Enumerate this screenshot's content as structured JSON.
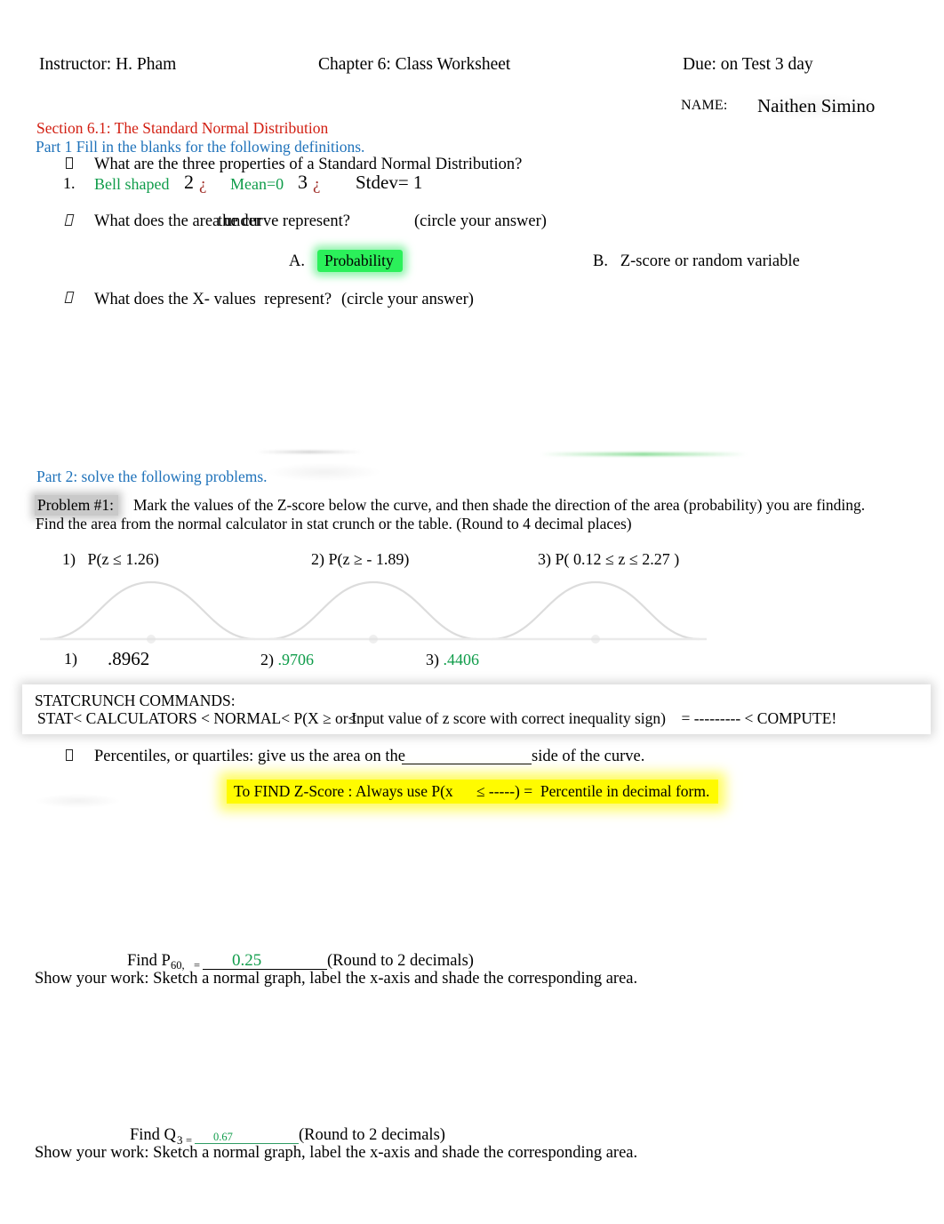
{
  "header": {
    "instructor": "Instructor: H. Pham",
    "title": "Chapter 6: Class Worksheet",
    "due": "Due: on Test 3 day",
    "name_label": "NAME:",
    "name_value": "Naithen Simino"
  },
  "section": {
    "title": "Section 6.1: The Standard Normal Distribution",
    "part1": "Part 1 Fill in the blanks for the following definitions.",
    "part2": "Part 2: solve the following problems."
  },
  "question1": {
    "prompt": "What are the three properties of a Standard Normal Distribution?",
    "num1": "1.",
    "prop1": "Bell shaped",
    "num2": "2",
    "q2": "¿",
    "prop2": "Mean=0",
    "num3": "3",
    "q3": "¿",
    "prop3": "Stdev= 1"
  },
  "question2": {
    "prompt_a": "What does the area under",
    "prompt_b": "the curve represent?",
    "prompt_c": "(circle your answer)",
    "optionA_label": "A.",
    "optionA_value": "Probability",
    "optionB": "B.   Z-score or random variable"
  },
  "question3": {
    "prompt_a": "What does the X- values  represent?",
    "prompt_b": "(circle your answer)"
  },
  "problem1": {
    "label": "Problem #1:",
    "line1": "Mark the values of the Z-score below the curve, and then shade the direction of the area (probability) you are finding.",
    "line2": "Find the area from the normal calculator in stat crunch or the table. (Round to 4 decimal places)",
    "items": [
      "1)   P(z ≤ 1.26)",
      "2) P(z ≥ - 1.89)",
      "3) P( 0.12 ≤ z ≤ 2.27 )"
    ],
    "answers": {
      "num1": "1)",
      "val1": ".8962",
      "ans2": "2) ",
      "val2": ".9706",
      "ans3": "3) ",
      "val3": ".4406"
    }
  },
  "statcrunch": {
    "line1": "STATCRUNCH COMMANDS:",
    "line2_a": "STAT< CALCULATORS < NORMAL< P(X ≥ or≤",
    "line2_b": "Input value of z score with correct inequality sign)",
    "line2_c": "= --------- < COMPUTE!"
  },
  "percentiles": {
    "label": "Percentiles, or quartiles:",
    "text_a": "give us the area on the",
    "text_b": "side of the curve."
  },
  "tip": {
    "text": "To FIND Z-Score : Always use P(x      ≤ -----) =  Percentile in decimal form."
  },
  "p60": {
    "find": "Find P",
    "sub": "60,",
    "eq": "=",
    "value": "0.25",
    "round": "(Round to 2 decimals)",
    "show_work": "Show your work: Sketch a normal graph, label the x-axis and shade the corresponding area."
  },
  "q3find": {
    "find": "Find Q",
    "sub": "3",
    "eq": "=",
    "value": "0.67",
    "round": "(Round to 2 decimals)",
    "show_work": "Show your work: Sketch a normal graph, label the x-axis and shade the corresponding area."
  },
  "colors": {
    "section_title": "#d21f12",
    "part_heading": "#1f72ba",
    "answer_green": "#0f9c4a",
    "highlight_green": "#2bf05a",
    "highlight_yellow": "#fffb00",
    "highlight_gray": "#c9c9c9",
    "inverted_q": "#9e2b25"
  }
}
